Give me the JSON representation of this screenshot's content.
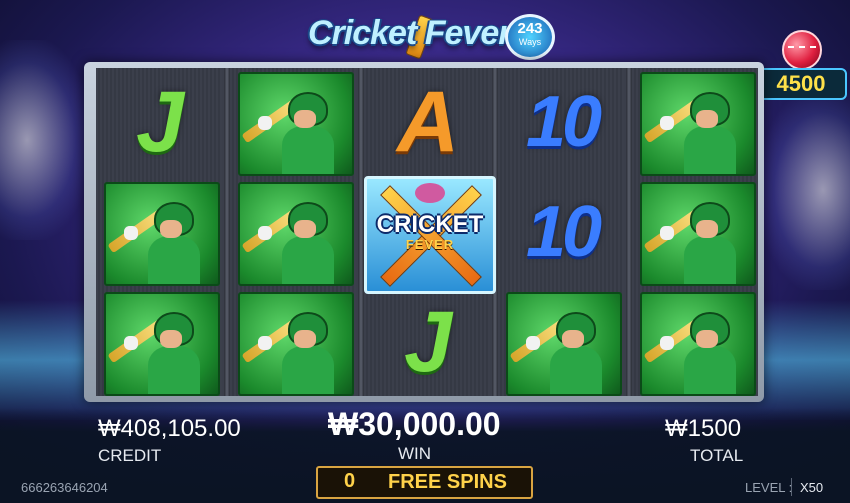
{
  "game": {
    "title": "Cricket Fever",
    "ways_number": "243",
    "ways_label": "Ways"
  },
  "ball_counter": {
    "value": "4500"
  },
  "reels": {
    "columns": [
      [
        "J",
        "Batsman",
        "Batsman"
      ],
      [
        "Batsman",
        "Batsman",
        "Batsman"
      ],
      [
        "A",
        "Cricket Fever Wild",
        "J"
      ],
      [
        "10",
        "10",
        "Batsman"
      ],
      [
        "Batsman",
        "Batsman",
        "Batsman"
      ]
    ],
    "wild_line1": "CRICKET",
    "wild_line2": "FEVER"
  },
  "stats": {
    "credit_value": "₩408,105.00",
    "credit_label": "CREDIT",
    "win_value": "₩30,000.00",
    "win_label": "WIN",
    "total_value": "₩1500",
    "total_label": "TOTAL"
  },
  "free_spins": {
    "count": "0",
    "label": "FREE SPINS"
  },
  "footer": {
    "session_id": "666263646204",
    "level_label": "LEVEL :",
    "level_value": "X50"
  }
}
